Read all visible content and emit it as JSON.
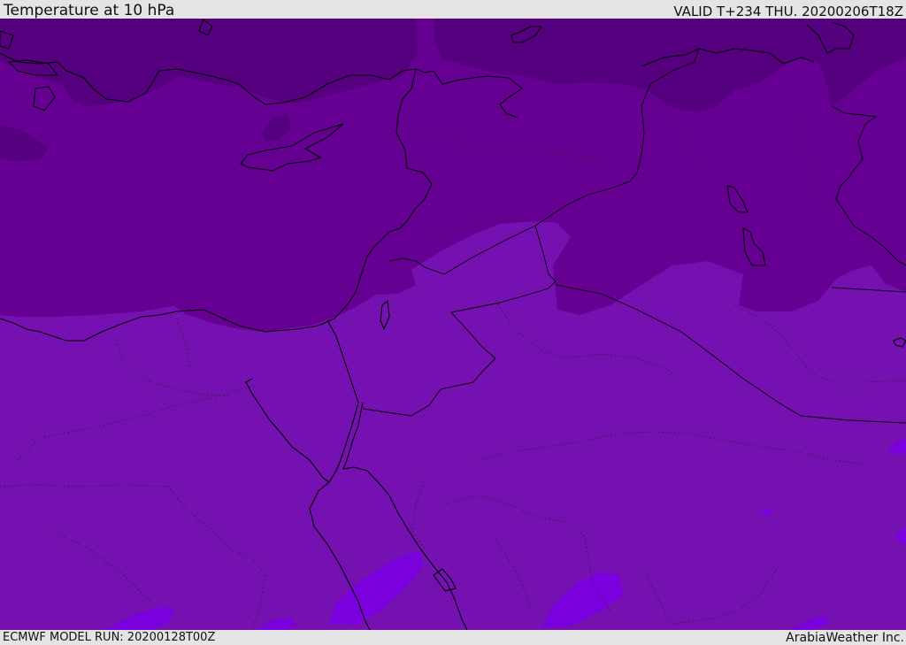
{
  "header": {
    "title": "Temperature at 10 hPa",
    "valid": "VALID T+234 THU. 20200206T18Z"
  },
  "footer": {
    "model_run": "ECMWF MODEL RUN: 20200128T00Z",
    "credit": "ArabiaWeather Inc."
  },
  "colors": {
    "band_darkest": "#55007f",
    "band_dark": "#650093",
    "band_mid": "#7511b0",
    "band_light": "#7a00dd",
    "coastline": "#000000",
    "bar_background": "#e4e4e4"
  }
}
